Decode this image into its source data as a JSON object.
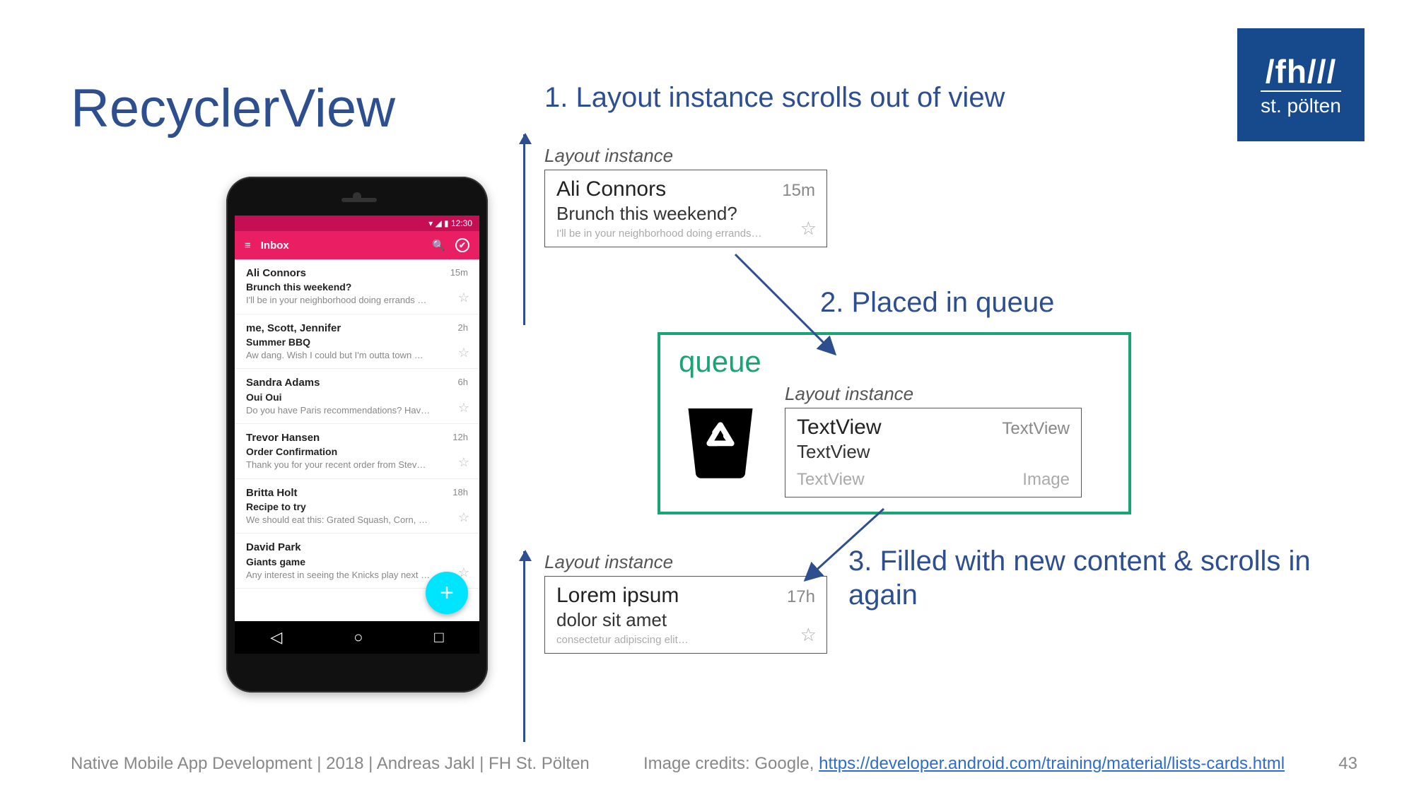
{
  "title": "RecyclerView",
  "logo": {
    "top": "/fh///",
    "bottom": "st. pölten"
  },
  "steps": {
    "s1": "1. Layout instance scrolls out of view",
    "s2": "2. Placed in queue",
    "s3": "3. Filled with new content & scrolls in again"
  },
  "phone": {
    "status": "▾ ◢ ▮ 12:30",
    "appbar": {
      "menu": "≡",
      "title": "Inbox",
      "search": "🔍",
      "check": "✔"
    },
    "nav": {
      "back": "◁",
      "home": "○",
      "recent": "□"
    },
    "fab": "+",
    "items": [
      {
        "who": "Ali Connors",
        "time": "15m",
        "subj": "Brunch this weekend?",
        "prev": "I'll be in your neighborhood doing errands …"
      },
      {
        "who": "me, Scott, Jennifer",
        "time": "2h",
        "subj": "Summer BBQ",
        "prev": "Aw dang. Wish I could but I'm outta town …"
      },
      {
        "who": "Sandra Adams",
        "time": "6h",
        "subj": "Oui Oui",
        "prev": "Do you have Paris recommendations? Hav…"
      },
      {
        "who": "Trevor Hansen",
        "time": "12h",
        "subj": "Order Confirmation",
        "prev": "Thank you for your recent order from Stev…"
      },
      {
        "who": "Britta Holt",
        "time": "18h",
        "subj": "Recipe to try",
        "prev": "We should eat this: Grated Squash, Corn, …"
      },
      {
        "who": "David Park",
        "time": "",
        "subj": "Giants game",
        "prev": "Any interest in seeing the Knicks play next …"
      }
    ]
  },
  "li_label": "Layout instance",
  "li1": {
    "name": "Ali Connors",
    "time": "15m",
    "subj": "Brunch this weekend?",
    "prev": "I'll be in your neighborhood doing errands…"
  },
  "li3": {
    "name": "Lorem ipsum",
    "time": "17h",
    "subj": "dolor sit amet",
    "prev": "consectetur adipiscing elit…"
  },
  "queue": {
    "label": "queue",
    "fields": {
      "f1": "TextView",
      "f2": "TextView",
      "f3": "TextView",
      "f4": "TextView",
      "f5": "Image"
    }
  },
  "footer": {
    "left": "Native Mobile App Development | 2018 | Andreas Jakl | FH St. Pölten",
    "credit_prefix": "Image credits: Google, ",
    "credit_url": "https://developer.android.com/training/material/lists-cards.html",
    "page": "43"
  },
  "star": "☆"
}
